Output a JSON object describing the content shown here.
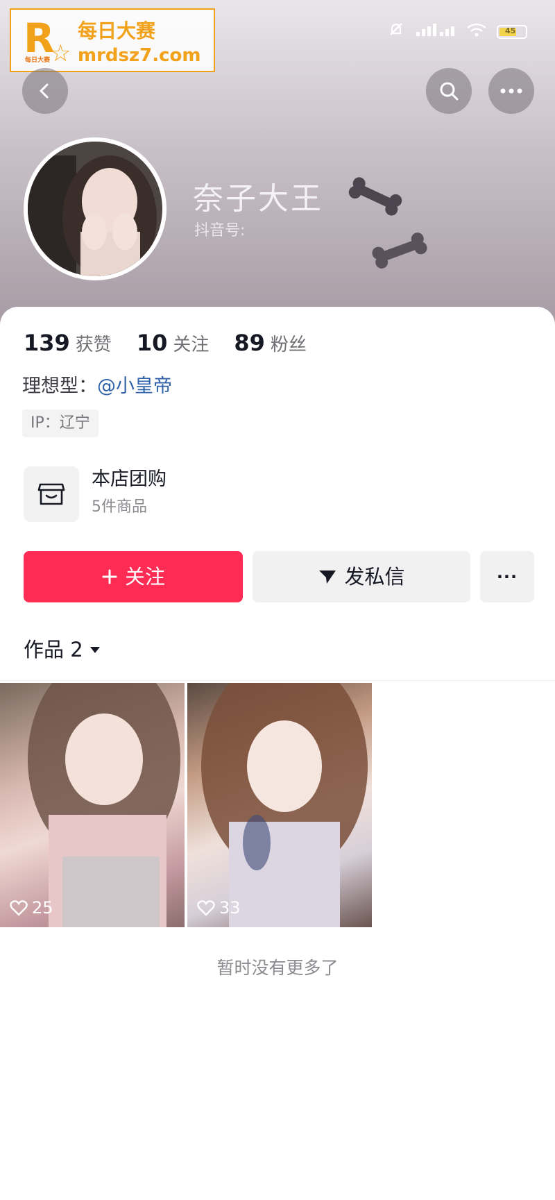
{
  "watermark": {
    "logo_letter": "R",
    "logo_small": "每日大赛",
    "line1": "每日大赛",
    "line2": "mrdsz7.com"
  },
  "status_bar": {
    "battery": "45"
  },
  "header": {
    "back_icon": "chevron-left-icon",
    "search_icon": "search-icon",
    "more_icon": "more-horizontal-icon"
  },
  "profile": {
    "nickname": "奈子大王",
    "douyin_id": "抖音号:"
  },
  "stats": [
    {
      "value": "139",
      "label": "获赞"
    },
    {
      "value": "10",
      "label": "关注"
    },
    {
      "value": "89",
      "label": "粉丝"
    }
  ],
  "ideal": {
    "label": "理想型：",
    "link": "@小皇帝"
  },
  "ip": "IP：辽宁",
  "store": {
    "title": "本店团购",
    "subtitle": "5件商品",
    "icon": "store-icon"
  },
  "actions": {
    "follow": "关注",
    "message": "发私信",
    "more": "···"
  },
  "works": {
    "tab_label": "作品 2",
    "items": [
      {
        "likes": "25"
      },
      {
        "likes": "33"
      }
    ]
  },
  "footer": {
    "no_more": "暂时没有更多了"
  },
  "colors": {
    "accent": "#fe2c55",
    "link": "#2f62a8"
  }
}
